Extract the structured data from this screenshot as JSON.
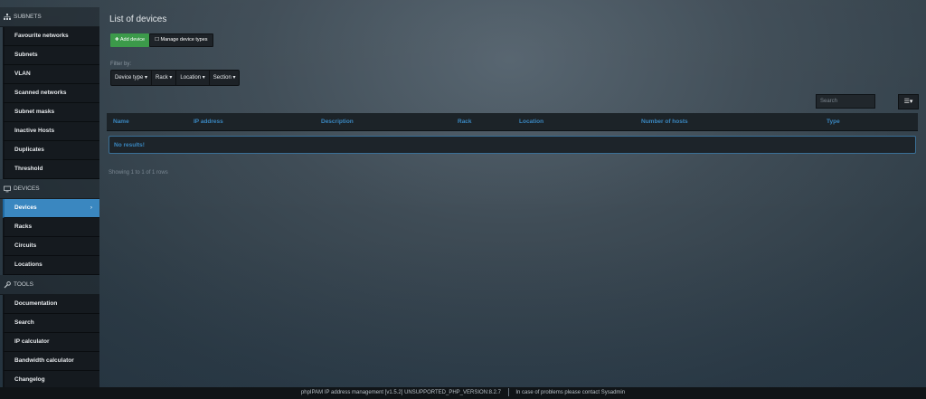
{
  "sidebar": {
    "sections": [
      {
        "title": "SUBNETS",
        "icon": "sitemap-icon",
        "items": [
          {
            "label": "Favourite networks"
          },
          {
            "label": "Subnets"
          },
          {
            "label": "VLAN"
          },
          {
            "label": "Scanned networks"
          },
          {
            "label": "Subnet masks"
          },
          {
            "label": "Inactive Hosts"
          },
          {
            "label": "Duplicates"
          },
          {
            "label": "Threshold"
          }
        ]
      },
      {
        "title": "DEVICES",
        "icon": "desktop-icon",
        "items": [
          {
            "label": "Devices",
            "active": true
          },
          {
            "label": "Racks"
          },
          {
            "label": "Circuits"
          },
          {
            "label": "Locations"
          }
        ]
      },
      {
        "title": "TOOLS",
        "icon": "wrench-icon",
        "items": [
          {
            "label": "Documentation"
          },
          {
            "label": "Search"
          },
          {
            "label": "IP calculator"
          },
          {
            "label": "Bandwidth calculator"
          },
          {
            "label": "Changelog"
          }
        ]
      }
    ],
    "active_chevron": "›"
  },
  "main": {
    "title": "List of devices",
    "add_device": "Add device",
    "manage_types": "Manage device types",
    "filter_label": "Filter by:",
    "filters": [
      "Device type",
      "Rack",
      "Location",
      "Section"
    ],
    "search_placeholder": "Search",
    "columns": [
      "Name",
      "IP address",
      "Description",
      "Rack",
      "Location",
      "Number of hosts",
      "Type"
    ],
    "no_results": "No results!",
    "showing": "Showing 1 to 1 of 1 rows"
  },
  "footer": {
    "left": "phpIPAM IP address management [v1.5.2] UNSUPPORTED_PHP_VERSION:8.2.7",
    "right": "In case of problems please contact Sysadmin"
  },
  "colors": {
    "accent": "#3a87c0",
    "add_button": "#3c9a4a"
  }
}
